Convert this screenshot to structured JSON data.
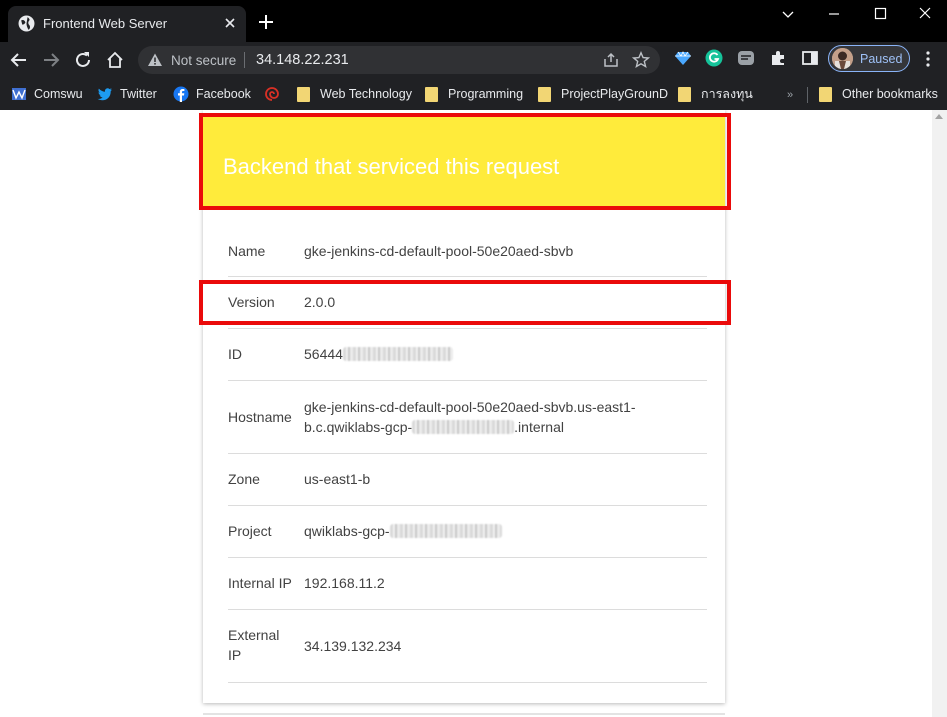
{
  "browser": {
    "tab_title": "Frontend Web Server",
    "security_label": "Not secure",
    "url": "34.148.22.231",
    "profile_label": "Paused",
    "accent": "#8ab4f8"
  },
  "bookmarks": {
    "items": [
      {
        "label": "Comswu",
        "icon": "comswu-icon"
      },
      {
        "label": "Twitter",
        "icon": "twitter-icon"
      },
      {
        "label": "Facebook",
        "icon": "facebook-icon"
      },
      {
        "label": "",
        "icon": "red-swirl-icon"
      },
      {
        "label": "Web Technology",
        "icon": "folder-icon"
      },
      {
        "label": "Programming",
        "icon": "folder-icon"
      },
      {
        "label": "ProjectPlayGrounD",
        "icon": "folder-icon"
      },
      {
        "label": "การลงทุน",
        "icon": "folder-icon"
      }
    ],
    "overflow": "»",
    "other": "Other bookmarks"
  },
  "card": {
    "header_color": "#ffeb3b",
    "highlight_color": "#ea0a0a",
    "title": "Backend that serviced this request",
    "rows": [
      {
        "label": "Name",
        "value": "gke-jenkins-cd-default-pool-50e20aed-sbvb"
      },
      {
        "label": "Version",
        "value": "2.0.0"
      },
      {
        "label": "ID",
        "value": "56444"
      },
      {
        "label": "Hostname",
        "value_line1": "gke-jenkins-cd-default-pool-50e20aed-sbvb.us-east1-",
        "value_line2_prefix": "b.c.qwiklabs-gcp-",
        "value_line2_suffix": ".internal"
      },
      {
        "label": "Zone",
        "value": "us-east1-b"
      },
      {
        "label": "Project",
        "value": "qwiklabs-gcp-"
      },
      {
        "label": "Internal IP",
        "value": "192.168.11.2"
      },
      {
        "label": "External IP",
        "label_line1": "External",
        "label_line2": "IP",
        "value": "34.139.132.234"
      }
    ]
  }
}
